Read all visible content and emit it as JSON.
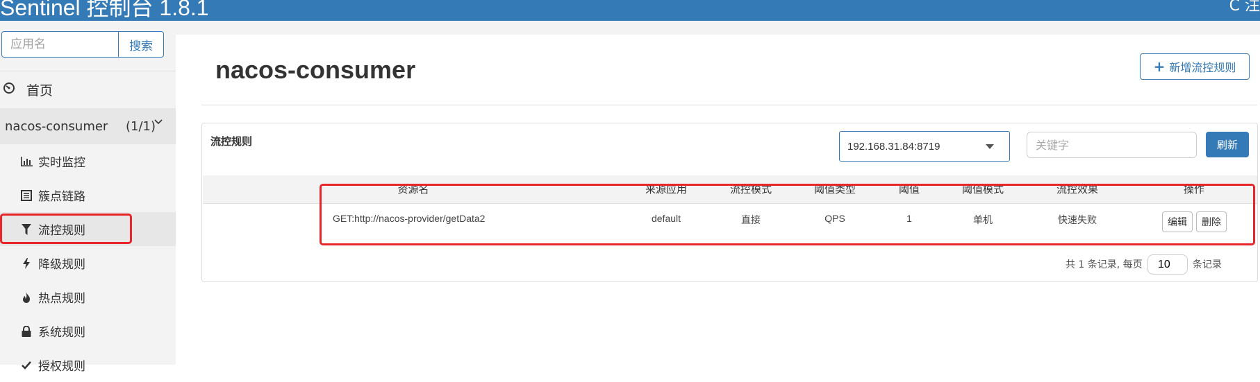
{
  "app": {
    "title": "Sentinel 控制台 1.8.1",
    "top_right": "C 注"
  },
  "search": {
    "placeholder": "应用名",
    "button": "搜索"
  },
  "nav": {
    "home": "首页",
    "app_name": "nacos-consumer",
    "app_count": "(1/1)",
    "items": [
      {
        "label": "实时监控",
        "icon": "bar-chart-icon"
      },
      {
        "label": "簇点链路",
        "icon": "list-icon"
      },
      {
        "label": "流控规则",
        "icon": "filter-icon"
      },
      {
        "label": "降级规则",
        "icon": "flash-icon"
      },
      {
        "label": "热点规则",
        "icon": "fire-icon"
      },
      {
        "label": "系统规则",
        "icon": "lock-icon"
      },
      {
        "label": "授权规则",
        "icon": "check-icon"
      }
    ]
  },
  "page": {
    "title": "nacos-consumer",
    "add_button": "新增流控规则"
  },
  "panel": {
    "label": "流控规则",
    "machine_select": "192.168.31.84:8719",
    "keyword_placeholder": "关键字",
    "refresh_button": "刷新"
  },
  "table": {
    "headers": [
      "资源名",
      "来源应用",
      "流控模式",
      "阈值类型",
      "阈值",
      "阈值模式",
      "流控效果",
      "操作"
    ],
    "rows": [
      {
        "resource": "GET:http://nacos-provider/getData2",
        "limit_app": "default",
        "strategy": "直接",
        "grade": "QPS",
        "count": "1",
        "cluster_mode": "单机",
        "effect": "快速失败",
        "edit": "编辑",
        "delete": "删除"
      }
    ]
  },
  "pager": {
    "prefix": "共 1 条记录, 每页",
    "page_size": "10",
    "suffix": "条记录"
  },
  "colors": {
    "primary": "#337ab7",
    "highlight": "#e8262a",
    "sidebar_bg": "#f3f3f3"
  }
}
